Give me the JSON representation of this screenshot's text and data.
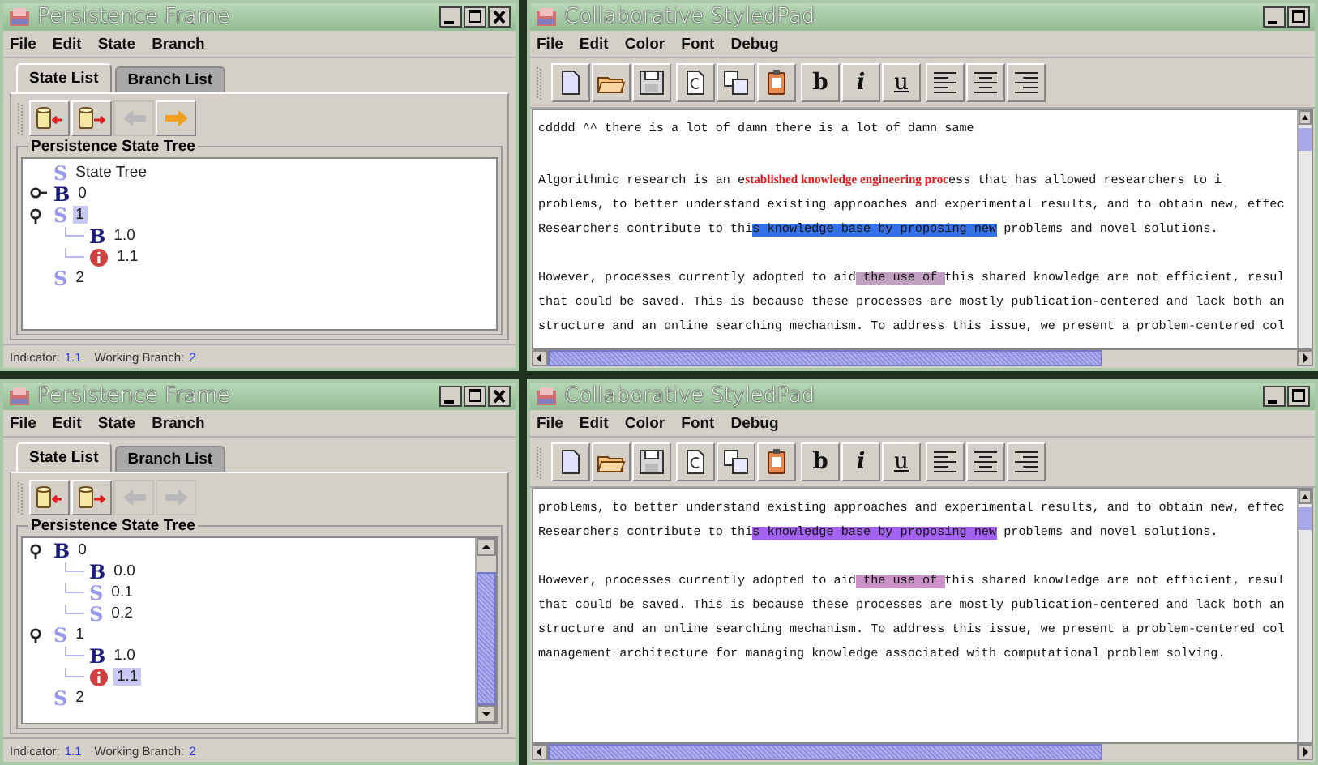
{
  "frames": [
    {
      "title": "Persistence Frame",
      "menu": [
        "File",
        "Edit",
        "State",
        "Branch"
      ],
      "tabs": [
        {
          "label": "State List",
          "selected": true
        },
        {
          "label": "Branch List",
          "selected": false
        }
      ],
      "tools": [
        {
          "kind": "import",
          "disabled": false
        },
        {
          "kind": "export",
          "disabled": false
        },
        {
          "kind": "back",
          "disabled": true
        },
        {
          "kind": "forward",
          "disabled": false
        }
      ],
      "group_title": "Persistence State Tree",
      "scrollbar": false,
      "tree": [
        {
          "kind": "state",
          "badge": "S",
          "label": "State Tree",
          "selected": false
        },
        {
          "kind": "branch",
          "badge": "B",
          "label": "0",
          "selected": false,
          "expanded": false
        },
        {
          "kind": "state",
          "badge": "S",
          "label": "1",
          "selected": true,
          "expanded": true,
          "children": [
            {
              "kind": "branch",
              "badge": "B",
              "label": "1.0",
              "selected": false
            },
            {
              "kind": "error",
              "label": "1.1",
              "selected": false
            }
          ]
        },
        {
          "kind": "state",
          "badge": "S",
          "label": "2",
          "selected": false
        }
      ],
      "status": {
        "indicator_label": "Indicator:",
        "indicator": "1.1",
        "branch_label": "Working Branch:",
        "branch": "2"
      }
    },
    {
      "title": "Persistence Frame",
      "menu": [
        "File",
        "Edit",
        "State",
        "Branch"
      ],
      "tabs": [
        {
          "label": "State List",
          "selected": true
        },
        {
          "label": "Branch List",
          "selected": false
        }
      ],
      "tools": [
        {
          "kind": "import",
          "disabled": false
        },
        {
          "kind": "export",
          "disabled": false
        },
        {
          "kind": "back",
          "disabled": true
        },
        {
          "kind": "forward",
          "disabled": true
        }
      ],
      "group_title": "Persistence State Tree",
      "scrollbar": true,
      "tree": [
        {
          "kind": "branch",
          "badge": "B",
          "label": "0",
          "selected": false,
          "expanded": true,
          "children": [
            {
              "kind": "branch",
              "badge": "B",
              "label": "0.0",
              "selected": false
            },
            {
              "kind": "state",
              "badge": "S",
              "label": "0.1",
              "selected": false
            },
            {
              "kind": "state",
              "badge": "S",
              "label": "0.2",
              "selected": false
            }
          ]
        },
        {
          "kind": "state",
          "badge": "S",
          "label": "1",
          "selected": false,
          "expanded": true,
          "children": [
            {
              "kind": "branch",
              "badge": "B",
              "label": "1.0",
              "selected": false
            },
            {
              "kind": "error",
              "label": "1.1",
              "selected": true
            }
          ]
        },
        {
          "kind": "state",
          "badge": "S",
          "label": "2",
          "selected": false
        }
      ],
      "status": {
        "indicator_label": "Indicator:",
        "indicator": "1.1",
        "branch_label": "Working Branch:",
        "branch": "2"
      }
    }
  ],
  "pads": [
    {
      "title": "Collaborative StyledPad",
      "menu": [
        "File",
        "Edit",
        "Color",
        "Font",
        "Debug"
      ],
      "tools": [
        [
          {
            "kind": "new"
          },
          {
            "kind": "open"
          },
          {
            "kind": "save"
          }
        ],
        [
          {
            "kind": "copy"
          },
          {
            "kind": "paste"
          },
          {
            "kind": "clipboard"
          }
        ],
        [
          {
            "kind": "bold",
            "label": "b"
          },
          {
            "kind": "italic",
            "label": "i"
          },
          {
            "kind": "underline",
            "label": "u"
          }
        ],
        [
          {
            "kind": "align-left"
          },
          {
            "kind": "align-center"
          },
          {
            "kind": "align-right"
          }
        ]
      ],
      "paragraphs": [
        [
          [
            {
              "kind": "plain",
              "text": "cdddd ^^ there is a lot of damn there is a lot of damn same"
            }
          ]
        ],
        [
          [
            {
              "kind": "plain",
              "text": "Algorithmic research is an e"
            },
            {
              "kind": "emphasis",
              "text": "stablished knowledge engineering proc"
            },
            {
              "kind": "plain",
              "text": "ess that has allowed researchers to i"
            }
          ],
          [
            {
              "kind": "plain",
              "text": "problems, to better understand existing approaches and experimental results, and to obtain new, effec"
            }
          ],
          [
            {
              "kind": "plain",
              "text": "Researchers contribute to thi"
            },
            {
              "kind": "highlight",
              "text": "s knowledge base by proposing new",
              "color": "#3470e8"
            },
            {
              "kind": "plain",
              "text": " problems and novel solutions."
            }
          ]
        ],
        [
          [
            {
              "kind": "plain",
              "text": "However, processes currently adopted to aid"
            },
            {
              "kind": "highlight",
              "text": " the use of ",
              "color": "#c0a0c0"
            },
            {
              "kind": "plain",
              "text": "this shared knowledge are not efficient, resul"
            }
          ],
          [
            {
              "kind": "plain",
              "text": "that could be saved. This is because these processes are mostly publication-centered and lack both an"
            }
          ],
          [
            {
              "kind": "plain",
              "text": "structure and an online searching mechanism. To address this issue, we present a problem-centered col"
            }
          ]
        ]
      ]
    },
    {
      "title": "Collaborative StyledPad",
      "menu": [
        "File",
        "Edit",
        "Color",
        "Font",
        "Debug"
      ],
      "tools": [
        [
          {
            "kind": "new"
          },
          {
            "kind": "open"
          },
          {
            "kind": "save"
          }
        ],
        [
          {
            "kind": "copy"
          },
          {
            "kind": "paste"
          },
          {
            "kind": "clipboard"
          }
        ],
        [
          {
            "kind": "bold",
            "label": "b"
          },
          {
            "kind": "italic",
            "label": "i"
          },
          {
            "kind": "underline",
            "label": "u"
          }
        ],
        [
          {
            "kind": "align-left"
          },
          {
            "kind": "align-center"
          },
          {
            "kind": "align-right"
          }
        ]
      ],
      "paragraphs": [
        [
          [
            {
              "kind": "plain",
              "text": "problems, to better understand existing approaches and experimental results, and to obtain new, effec"
            }
          ],
          [
            {
              "kind": "plain",
              "text": "Researchers contribute to thi"
            },
            {
              "kind": "highlight",
              "text": "s knowledge base by proposing new",
              "color": "#a462f2"
            },
            {
              "kind": "plain",
              "text": " problems and novel solutions."
            }
          ]
        ],
        [
          [
            {
              "kind": "plain",
              "text": "However, processes currently adopted to aid"
            },
            {
              "kind": "highlight",
              "text": " the use of ",
              "color": "#cc92c8"
            },
            {
              "kind": "plain",
              "text": "this shared knowledge are not efficient, resul"
            }
          ],
          [
            {
              "kind": "plain",
              "text": "that could be saved. This is because these processes are mostly publication-centered and lack both an"
            }
          ],
          [
            {
              "kind": "plain",
              "text": "structure and an online searching mechanism. To address this issue, we present a problem-centered col"
            }
          ],
          [
            {
              "kind": "plain",
              "text": "management architecture for managing knowledge associated with computational problem solving."
            }
          ]
        ]
      ]
    }
  ]
}
